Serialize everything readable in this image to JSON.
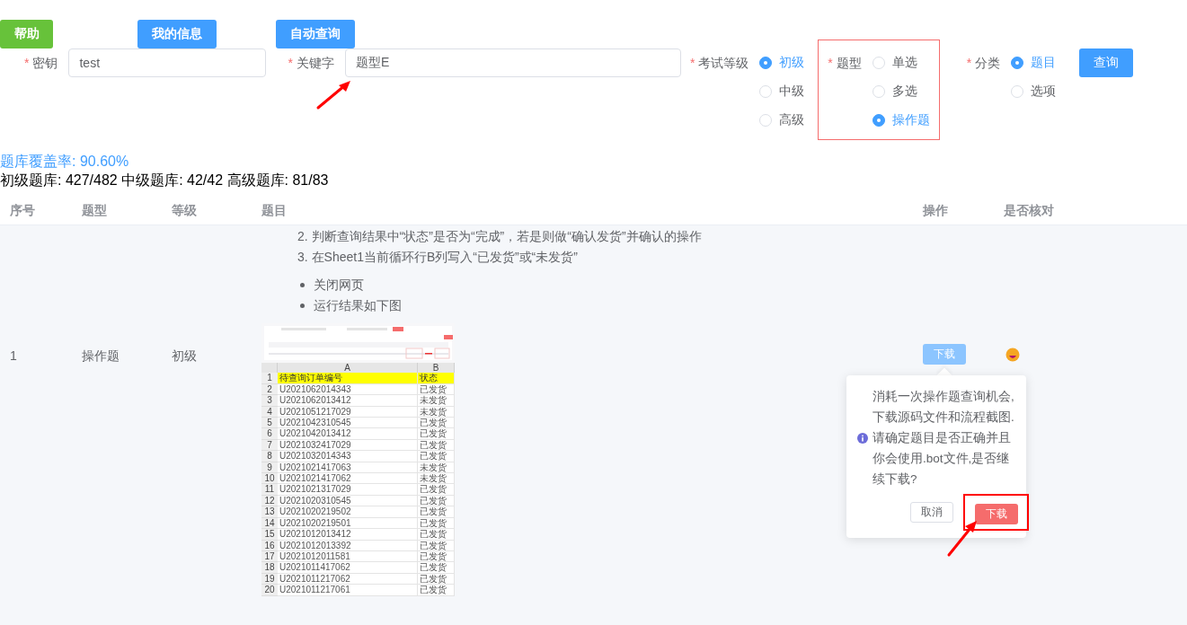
{
  "top_buttons": [
    {
      "label": "帮助",
      "kind": "success"
    },
    {
      "label": "我的信息",
      "kind": "primary"
    },
    {
      "label": "自动查询",
      "kind": "primary"
    }
  ],
  "form": {
    "fields": [
      {
        "required_mark": "*",
        "label": "密钥",
        "value": "test"
      },
      {
        "required_mark": "*",
        "label": "关键字",
        "value": "题型E"
      }
    ],
    "radio_groups": [
      {
        "required_mark": "*",
        "label": "考试等级",
        "highlighted": false,
        "options": [
          {
            "label": "初级",
            "selected": true
          },
          {
            "label": "中级",
            "selected": false
          },
          {
            "label": "高级",
            "selected": false
          }
        ]
      },
      {
        "required_mark": "*",
        "label": "题型",
        "highlighted": true,
        "options": [
          {
            "label": "单选",
            "selected": false
          },
          {
            "label": "多选",
            "selected": false
          },
          {
            "label": "操作题",
            "selected": true
          }
        ]
      },
      {
        "required_mark": "*",
        "label": "分类",
        "highlighted": false,
        "options": [
          {
            "label": "题目",
            "selected": true
          },
          {
            "label": "选项",
            "selected": false
          }
        ]
      }
    ],
    "submit": "查询"
  },
  "coverage": "题库覆盖率: 90.60%",
  "stats": "初级题库: 427/482 中级题库: 42/42 高级题库: 81/83",
  "table": {
    "columns": [
      "序号",
      "题型",
      "等级",
      "题目",
      "操作",
      "是否核对"
    ],
    "rows": [
      {
        "index": "1",
        "type": "操作题",
        "level": "初级",
        "steps": [
          "2. 判断查询结果中“状态”是否为“完成”，若是则做“确认发货”并确认的操作",
          "3. 在Sheet1当前循环行B列写入“已发货”或“未发货”"
        ],
        "bullets": [
          "关闭网页",
          "运行结果如下图"
        ],
        "result_sheet": {
          "columns": [
            "A",
            "B"
          ],
          "rows": [
            {
              "num": "1",
              "order": "待查询订单编号",
              "status": "状态",
              "header": true
            },
            {
              "num": "2",
              "order": "U2021062014343",
              "status": "已发货",
              "header": false
            },
            {
              "num": "3",
              "order": "U2021062013412",
              "status": "未发货",
              "header": false
            },
            {
              "num": "4",
              "order": "U2021051217029",
              "status": "未发货",
              "header": false
            },
            {
              "num": "5",
              "order": "U2021042310545",
              "status": "已发货",
              "header": false
            },
            {
              "num": "6",
              "order": "U2021042013412",
              "status": "已发货",
              "header": false
            },
            {
              "num": "7",
              "order": "U2021032417029",
              "status": "已发货",
              "header": false
            },
            {
              "num": "8",
              "order": "U2021032014343",
              "status": "已发货",
              "header": false
            },
            {
              "num": "9",
              "order": "U2021021417063",
              "status": "未发货",
              "header": false
            },
            {
              "num": "10",
              "order": "U2021021417062",
              "status": "未发货",
              "header": false
            },
            {
              "num": "11",
              "order": "U2021021317029",
              "status": "已发货",
              "header": false
            },
            {
              "num": "12",
              "order": "U2021020310545",
              "status": "已发货",
              "header": false
            },
            {
              "num": "13",
              "order": "U2021020219502",
              "status": "已发货",
              "header": false
            },
            {
              "num": "14",
              "order": "U2021020219501",
              "status": "已发货",
              "header": false
            },
            {
              "num": "15",
              "order": "U2021012013412",
              "status": "已发货",
              "header": false
            },
            {
              "num": "16",
              "order": "U2021012013392",
              "status": "已发货",
              "header": false
            },
            {
              "num": "17",
              "order": "U2021012011581",
              "status": "已发货",
              "header": false
            },
            {
              "num": "18",
              "order": "U2021011417062",
              "status": "已发货",
              "header": false
            },
            {
              "num": "19",
              "order": "U2021011217062",
              "status": "已发货",
              "header": false
            },
            {
              "num": "20",
              "order": "U2021011217061",
              "status": "已发货",
              "header": false
            }
          ]
        },
        "action": "下载"
      }
    ]
  },
  "popconfirm": {
    "message": "消耗一次操作题查询机会,下载源码文件和流程截图. 请确定题目是否正确并且你会使用.bot文件,是否继续下载?",
    "cancel": "取消",
    "confirm": "下载",
    "confirm_highlighted": true
  }
}
